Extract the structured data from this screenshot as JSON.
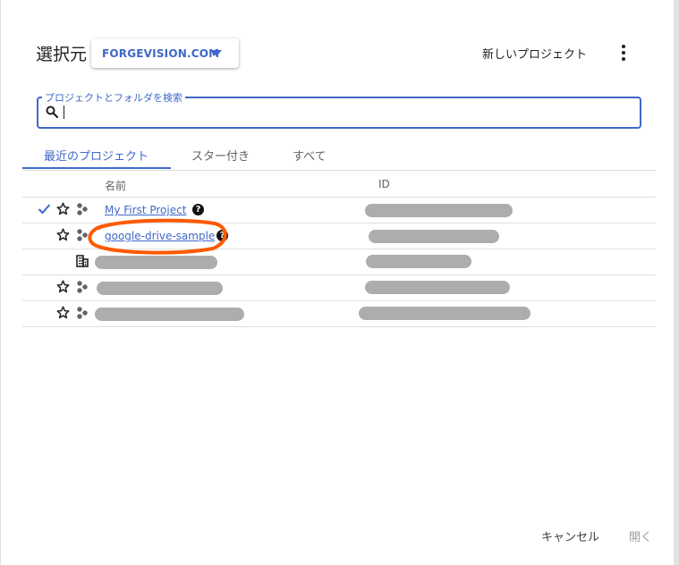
{
  "dialog": {
    "title": "選択元",
    "org_selector": {
      "label": "FORGEVISION.COM"
    },
    "new_project_label": "新しいプロジェクト"
  },
  "search": {
    "label": "プロジェクトとフォルダを検索",
    "value": ""
  },
  "tabs": [
    {
      "label": "最近のプロジェクト",
      "active": true
    },
    {
      "label": "スター付き",
      "active": false
    },
    {
      "label": "すべて",
      "active": false
    }
  ],
  "table": {
    "columns": [
      "名前",
      "ID"
    ],
    "rows": [
      {
        "name": "My First Project",
        "selected": true,
        "type": "project",
        "help": "?"
      },
      {
        "name": "google-drive-sample",
        "selected": false,
        "type": "project",
        "help": "?"
      },
      {
        "name": "",
        "selected": false,
        "type": "organization"
      },
      {
        "name": "",
        "selected": false,
        "type": "project"
      },
      {
        "name": "",
        "selected": false,
        "type": "project"
      }
    ]
  },
  "footer": {
    "cancel_label": "キャンセル",
    "open_label": "開く"
  },
  "colors": {
    "accent": "#3f68c8",
    "annotation": "#ff5a00",
    "redaction": "#adadad"
  }
}
